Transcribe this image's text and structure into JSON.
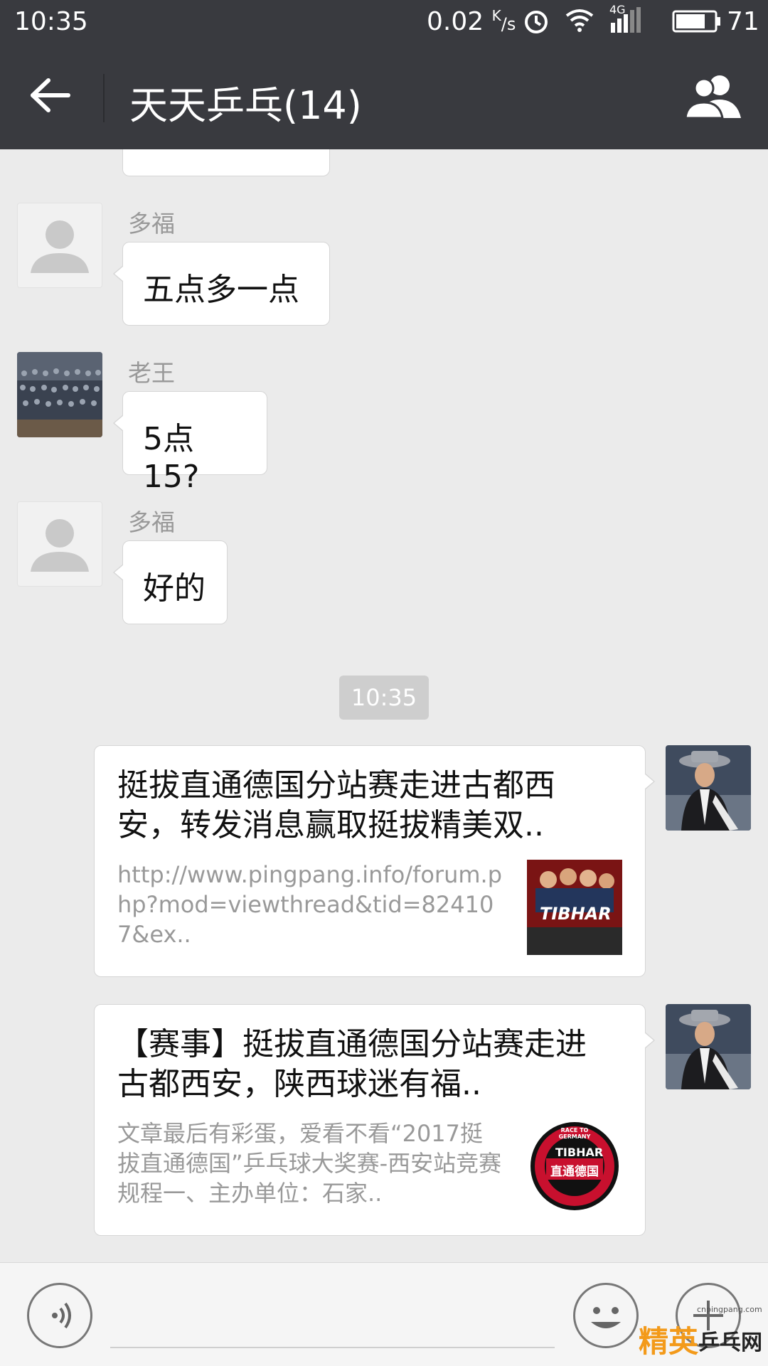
{
  "status_bar": {
    "time": "10:35",
    "net_speed": "0.02",
    "net_unit_top": "K",
    "net_unit_bottom": "/s",
    "network_type": "4G",
    "battery": "71",
    "icons": [
      "alarm-icon",
      "wifi-icon",
      "signal-icon",
      "battery-icon"
    ]
  },
  "header": {
    "back_icon": "arrow-left-icon",
    "title": "天天乒乓(14)",
    "members_icon": "group-members-icon"
  },
  "messages": [
    {
      "sender": "多福",
      "text": "五点多一点",
      "avatar": "default-avatar"
    },
    {
      "sender": "老王",
      "text": "5点15?",
      "avatar": "photo-avatar"
    },
    {
      "sender": "多福",
      "text": "好的",
      "avatar": "default-avatar"
    }
  ],
  "timestamp": "10:35",
  "links": [
    {
      "title": "挺拔直通德国分站赛走进古都西安，转发消息赢取挺拔精美双..",
      "desc": "http://www.pingpang.info/forum.php?mod=viewthread&tid=824107&ex..",
      "thumb_text": "TIBHAR"
    },
    {
      "title": "【赛事】挺拔直通德国分站赛走进古都西安，陕西球迷有福..",
      "desc": "文章最后有彩蛋，爱看不看“2017挺拔直通德国”乒乓球大奖赛-西安站竞赛规程一、主办单位：石家..",
      "thumb_text": "TIBHAR",
      "thumb_subtext": "直通德国",
      "thumb_ring": "RACE TO GERMANY"
    }
  ],
  "input_bar": {
    "voice_icon": "voice-icon",
    "emoji_icon": "emoji-icon",
    "more_icon": "plus-icon"
  },
  "watermark": {
    "text_jing": "精英",
    "text_ppw": "乒乓网",
    "url": "cnpingpang.com"
  },
  "colors": {
    "bar": "#393a3f",
    "background": "#ebebeb",
    "bubble": "#ffffff",
    "timestamp_bg": "#cecece"
  }
}
